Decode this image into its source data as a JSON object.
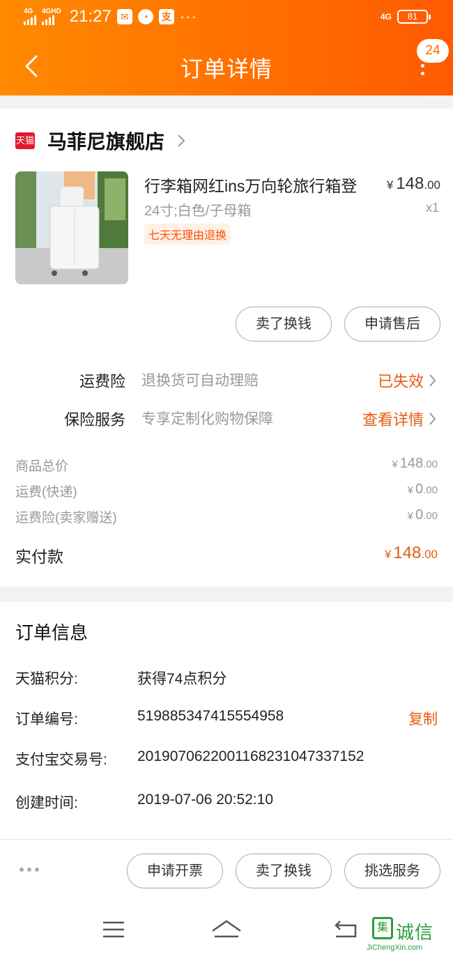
{
  "status_bar": {
    "sim1": "4G",
    "sim2": "4GHD",
    "time": "21:27",
    "net": "4G",
    "battery": "81",
    "dots": "···"
  },
  "header": {
    "title": "订单详情",
    "badge_count": "24"
  },
  "store": {
    "tag": "天猫",
    "name": "马菲尼旗舰店"
  },
  "product": {
    "title": "行李箱网红ins万向轮旅行箱登",
    "sku": "24寸;白色/子母箱",
    "tag": "七天无理由退换",
    "price_symbol": "¥",
    "price_int": "148",
    "price_dec": ".00",
    "qty": "x1"
  },
  "item_actions": {
    "sell": "卖了换钱",
    "after_sale": "申请售后"
  },
  "insurance": [
    {
      "label": "运费险",
      "desc": "退换货可自动理赔",
      "status": "已失效"
    },
    {
      "label": "保险服务",
      "desc": "专享定制化购物保障",
      "status": "查看详情"
    }
  ],
  "fees": [
    {
      "label": "商品总价",
      "symbol": "¥",
      "int": "148",
      "dec": ".00"
    },
    {
      "label": "运费(快递)",
      "symbol": "¥",
      "int": "0",
      "dec": ".00"
    },
    {
      "label": "运费险(卖家赠送)",
      "symbol": "¥",
      "int": "0",
      "dec": ".00"
    }
  ],
  "paid": {
    "label": "实付款",
    "symbol": "¥",
    "int": "148",
    "dec": ".00"
  },
  "order_info": {
    "title": "订单信息",
    "rows": [
      {
        "key": "天猫积分:",
        "value": "获得74点积分"
      },
      {
        "key": "订单编号:",
        "value": "519885347415554958",
        "action": "复制"
      },
      {
        "key": "支付宝交易号:",
        "value": "2019070622001168231047337152"
      },
      {
        "key": "创建时间:",
        "value": "2019-07-06 20:52:10"
      }
    ]
  },
  "bottom_actions": {
    "invoice": "申请开票",
    "sell": "卖了换钱",
    "services": "挑选服务"
  },
  "watermark": {
    "logo_char": "集",
    "text": "诚信",
    "url": "JiChengXin.com"
  },
  "colors": {
    "header_start": "#ff8a00",
    "header_end": "#ff5a00",
    "accent": "#e75a14"
  }
}
